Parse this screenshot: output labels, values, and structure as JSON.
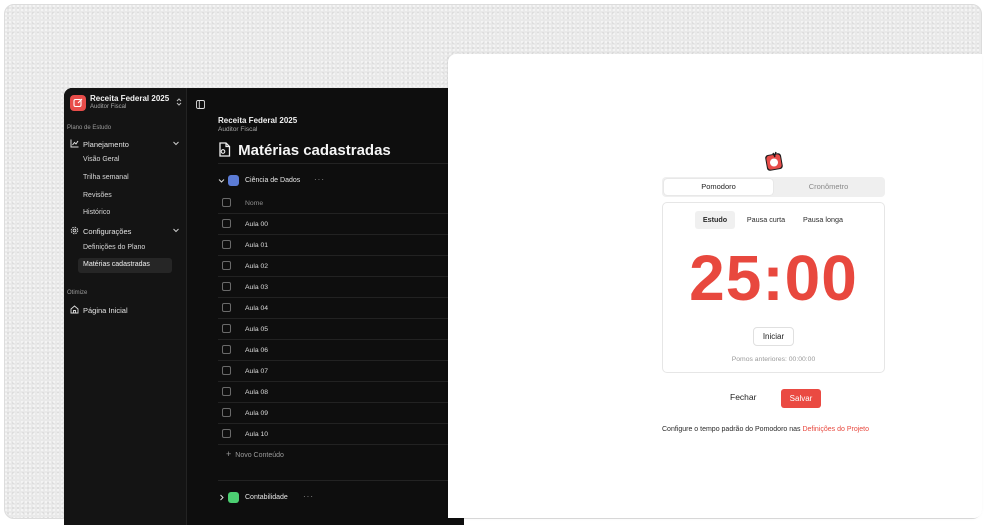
{
  "colors": {
    "accent": "#e8483e",
    "sidebar_bg": "#141414",
    "content_bg": "#0e0e0e",
    "ciencia_swatch": "#5b7bd5",
    "contabilidade_swatch": "#4ccf72"
  },
  "workspace": {
    "title": "Receita Federal 2025",
    "subtitle": "Auditor Fiscal",
    "logo_icon": "edit-square-icon",
    "switch_icon": "chevron-updown-icon"
  },
  "sidebar": {
    "section_label": "Plano de Estudo",
    "planejamento": {
      "label": "Planejamento",
      "icon": "chart-line-icon"
    },
    "planejamento_items": [
      "Visão Geral",
      "Trilha semanal",
      "Revisões",
      "Histórico"
    ],
    "configuracoes": {
      "label": "Configurações",
      "icon": "gear-icon"
    },
    "configuracoes_items": [
      "Definições do Plano",
      "Matérias cadastradas"
    ],
    "otimize_label": "Otimize",
    "home": {
      "label": "Página Inicial",
      "icon": "home-icon"
    }
  },
  "main": {
    "breadcrumb_title": "Receita Federal 2025",
    "breadcrumb_sub": "Auditor Fiscal",
    "page_title": "Matérias cadastradas",
    "group1": {
      "name": "Ciência de Dados",
      "more": "···"
    },
    "table_header": "Nome",
    "rows": [
      "Aula 00",
      "Aula 01",
      "Aula 02",
      "Aula 03",
      "Aula 04",
      "Aula 05",
      "Aula 06",
      "Aula 07",
      "Aula 08",
      "Aula 09",
      "Aula 10"
    ],
    "add_label": "Novo Conteúdo",
    "group2": {
      "name": "Contabilidade",
      "more": "···"
    }
  },
  "modal": {
    "tabs": [
      "Pomodoro",
      "Cronômetro"
    ],
    "modes": [
      "Estudo",
      "Pausa curta",
      "Pausa longa"
    ],
    "timer": "25:00",
    "start_label": "Iniciar",
    "previous": "Pomos anteriores: 00:00:00",
    "close_label": "Fechar",
    "save_label": "Salvar",
    "footer_text": "Configure o tempo padrão do Pomodoro nas ",
    "footer_link": "Definições do Projeto"
  }
}
